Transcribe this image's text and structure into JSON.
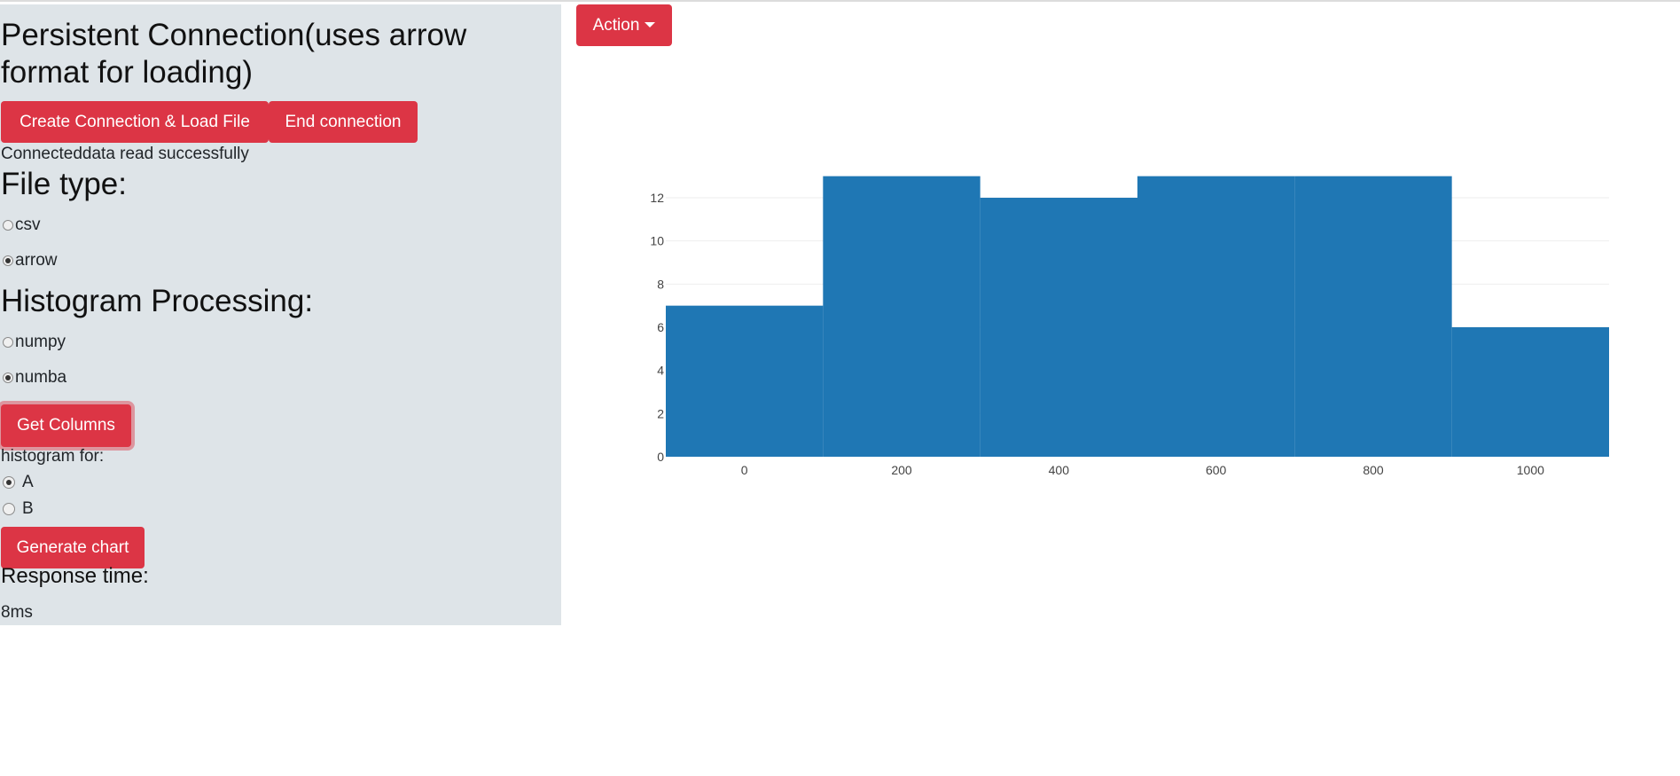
{
  "sidebar": {
    "title": "Persistent Connection(uses arrow format for loading)",
    "create_button": "Create Connection & Load File",
    "end_button": "End connection",
    "status": "Connecteddata read successfully",
    "file_type_heading": "File type:",
    "file_types": [
      {
        "label": "csv",
        "checked": false
      },
      {
        "label": "arrow",
        "checked": true
      }
    ],
    "processing_heading": "Histogram Processing:",
    "processing_options": [
      {
        "label": "numpy",
        "checked": false
      },
      {
        "label": "numba",
        "checked": true
      }
    ],
    "get_columns_button": "Get Columns",
    "histogram_for_label": "histogram for:",
    "columns": [
      {
        "label": "A",
        "checked": true
      },
      {
        "label": "B",
        "checked": false
      }
    ],
    "generate_button": "Generate chart",
    "response_heading": "Response time:",
    "response_value": "8ms"
  },
  "toolbar": {
    "action_button": "Action"
  },
  "colors": {
    "button": "#dc3545",
    "sidebar_bg": "#dee4e8",
    "bar": "#1f77b4"
  },
  "chart_data": {
    "type": "bar",
    "bins": [
      {
        "start": -100,
        "end": 100,
        "count": 7
      },
      {
        "start": 100,
        "end": 300,
        "count": 13
      },
      {
        "start": 300,
        "end": 500,
        "count": 12
      },
      {
        "start": 500,
        "end": 700,
        "count": 13
      },
      {
        "start": 700,
        "end": 900,
        "count": 13
      },
      {
        "start": 900,
        "end": 1100,
        "count": 6
      }
    ],
    "xlim": [
      -100,
      1100
    ],
    "ylim": [
      0,
      13
    ],
    "x_ticks": [
      0,
      200,
      400,
      600,
      800,
      1000
    ],
    "y_ticks": [
      0,
      2,
      4,
      6,
      8,
      10,
      12
    ],
    "grid": true
  }
}
